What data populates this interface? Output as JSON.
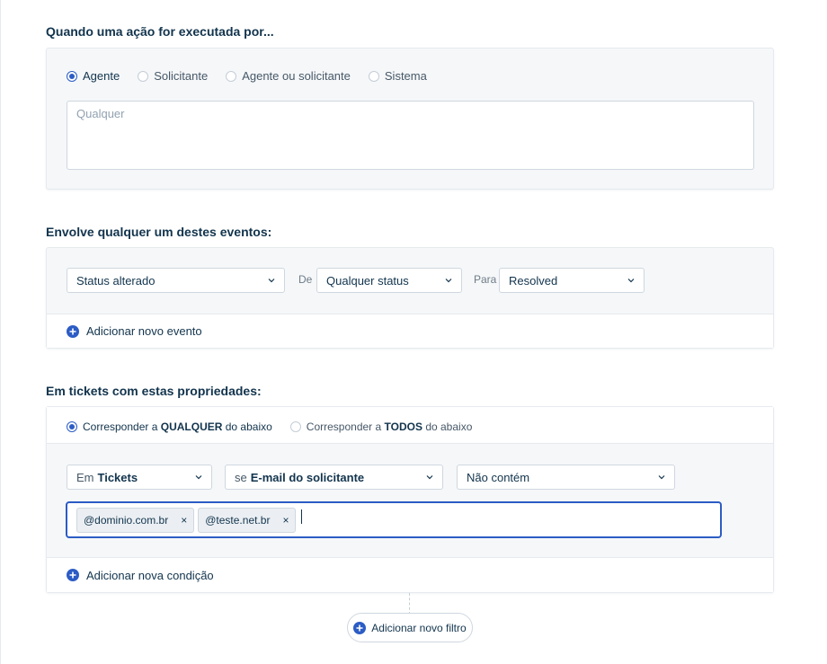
{
  "section1": {
    "title": "Quando uma ação for executada por...",
    "options": [
      "Agente",
      "Solicitante",
      "Agente ou solicitante",
      "Sistema"
    ],
    "selected": "Agente",
    "placeholder": "Qualquer"
  },
  "section2": {
    "title": "Envolve qualquer um destes eventos:",
    "event_select": "Status alterado",
    "from_label": "De",
    "from_select": "Qualquer status",
    "to_label": "Para",
    "to_select": "Resolved",
    "add_label": "Adicionar novo evento"
  },
  "section3": {
    "title": "Em tickets com estas propriedades:",
    "match_any": {
      "pre": "Corresponder a",
      "strong": "QUALQUER",
      "post": "do abaixo"
    },
    "match_all": {
      "pre": "Corresponder a",
      "strong": "TODOS",
      "post": "do abaixo"
    },
    "selected_match": "any",
    "condition": {
      "scope_prefix": "Em",
      "scope_value": "Tickets",
      "field_prefix": "se",
      "field_value": "E-mail do solicitante",
      "operator": "Não contém"
    },
    "tags": [
      "@dominio.com.br",
      "@teste.net.br"
    ],
    "add_label": "Adicionar nova condição"
  },
  "add_filter_label": "Adicionar novo filtro",
  "colors": {
    "accent": "#2c5cc5",
    "card_bg": "#f5f7f9",
    "border": "#cfd7df"
  }
}
